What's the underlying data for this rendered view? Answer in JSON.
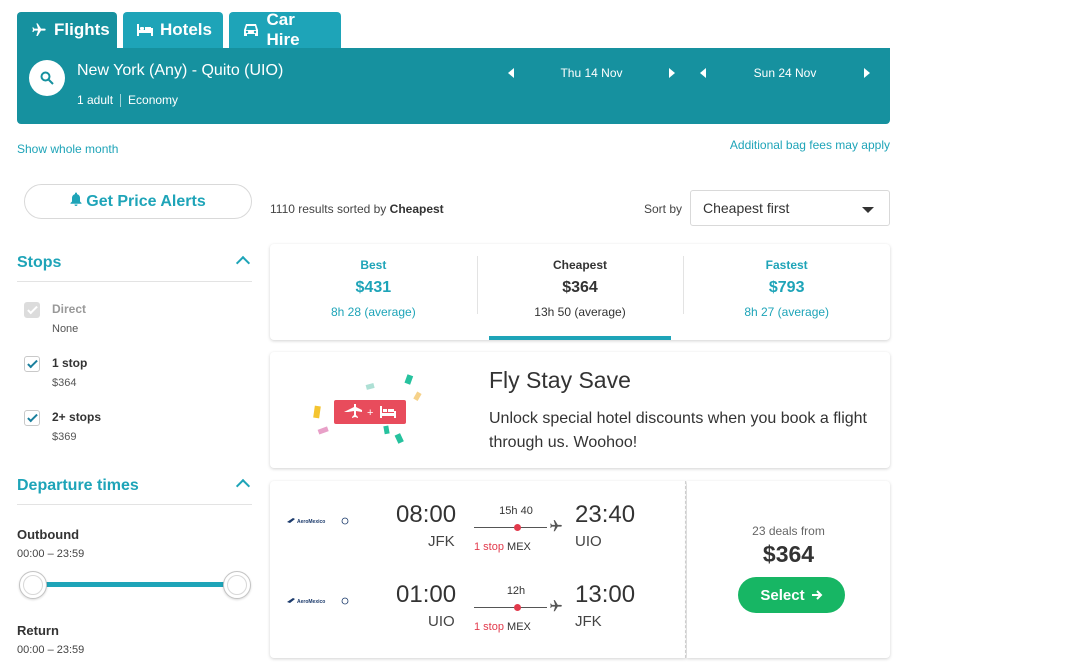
{
  "tabs": [
    {
      "label": "Flights",
      "icon": "plane-icon",
      "active": true
    },
    {
      "label": "Hotels",
      "icon": "bed-icon",
      "active": false
    },
    {
      "label": "Car Hire",
      "icon": "car-icon",
      "active": false
    }
  ],
  "search": {
    "route": "New York (Any) - Quito (UIO)",
    "passengers": "1 adult",
    "cabin": "Economy",
    "depart_date": "Thu 14 Nov",
    "return_date": "Sun 24 Nov"
  },
  "links": {
    "show_month": "Show whole month",
    "bag_fees": "Additional bag fees may apply"
  },
  "sidebar": {
    "alerts_label": "Get Price Alerts",
    "stops": {
      "title": "Stops",
      "options": [
        {
          "label": "Direct",
          "price": "None",
          "checked": true,
          "disabled": true
        },
        {
          "label": "1 stop",
          "price": "$364",
          "checked": true,
          "disabled": false
        },
        {
          "label": "2+ stops",
          "price": "$369",
          "checked": true,
          "disabled": false
        }
      ]
    },
    "departure_times": {
      "title": "Departure times",
      "outbound_label": "Outbound",
      "outbound_range": "00:00 – 23:59",
      "return_label": "Return",
      "return_range": "00:00 – 23:59"
    }
  },
  "results": {
    "count": "1110",
    "sorted_prefix": "results sorted by",
    "sorted_by": "Cheapest",
    "sort_label": "Sort by",
    "sort_value": "Cheapest first"
  },
  "sort_tabs": [
    {
      "name": "Best",
      "price": "$431",
      "duration": "8h 28 (average)",
      "selected": false
    },
    {
      "name": "Cheapest",
      "price": "$364",
      "duration": "13h 50 (average)",
      "selected": true
    },
    {
      "name": "Fastest",
      "price": "$793",
      "duration": "8h 27 (average)",
      "selected": false
    }
  ],
  "promo": {
    "title": "Fly Stay Save",
    "text": "Unlock special hotel discounts when you book a flight through us. Woohoo!"
  },
  "flight": {
    "legs": [
      {
        "airline": "AeroMexico",
        "dep_time": "08:00",
        "dep_code": "JFK",
        "duration": "15h 40",
        "stops": "1 stop",
        "via": "MEX",
        "arr_time": "23:40",
        "arr_code": "UIO"
      },
      {
        "airline": "AeroMexico",
        "dep_time": "01:00",
        "dep_code": "UIO",
        "duration": "12h",
        "stops": "1 stop",
        "via": "MEX",
        "arr_time": "13:00",
        "arr_code": "JFK"
      }
    ],
    "deals": "23 deals from",
    "price": "$364",
    "select_label": "Select"
  },
  "colors": {
    "teal": "#1ea4b8",
    "teal_dark": "#16919f",
    "green": "#17b664",
    "red": "#e23a4c",
    "promo_red": "#e84c5c"
  }
}
